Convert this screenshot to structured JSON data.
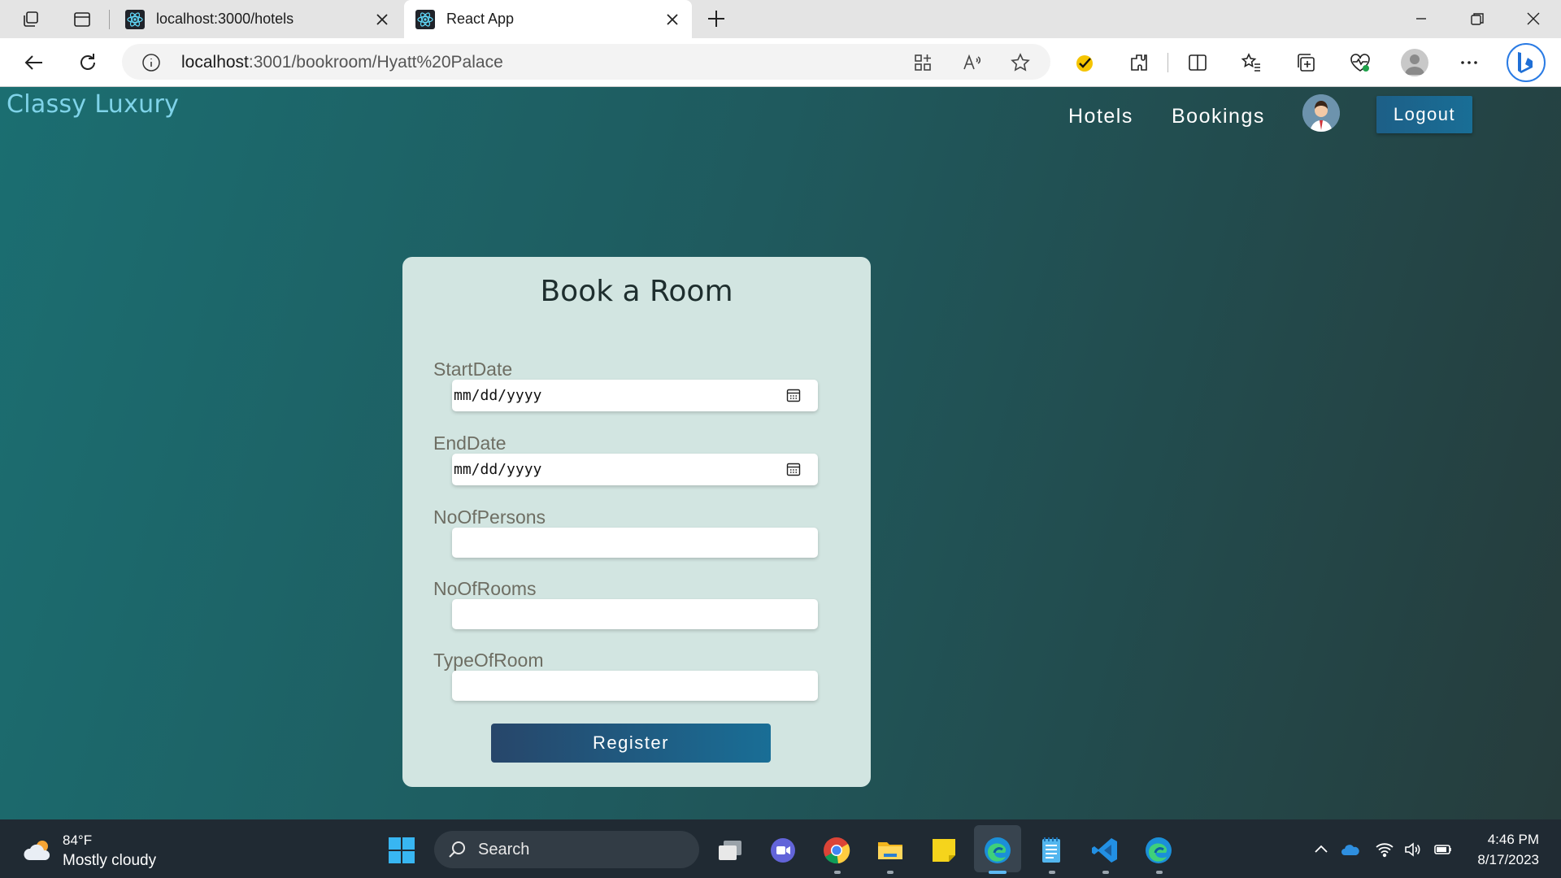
{
  "browser": {
    "tabs": [
      {
        "title": "localhost:3000/hotels",
        "active": false
      },
      {
        "title": "React App",
        "active": true
      }
    ],
    "url_host": "localhost",
    "url_path": ":3001/bookroom/Hyatt%20Palace"
  },
  "navbar": {
    "brand": "Classy Luxury",
    "links": [
      "Hotels",
      "Bookings"
    ],
    "logout_label": "Logout"
  },
  "form": {
    "title": "Book a Room",
    "fields": [
      {
        "label": "StartDate",
        "placeholder": "mm/dd/yyyy",
        "type": "date"
      },
      {
        "label": "EndDate",
        "placeholder": "mm/dd/yyyy",
        "type": "date"
      },
      {
        "label": "NoOfPersons",
        "value": ""
      },
      {
        "label": "NoOfRooms",
        "value": ""
      },
      {
        "label": "TypeOfRoom",
        "value": ""
      }
    ],
    "submit_label": "Register"
  },
  "taskbar": {
    "weather_temp": "84°F",
    "weather_desc": "Mostly cloudy",
    "search_label": "Search",
    "time": "4:46 PM",
    "date": "8/17/2023"
  },
  "colors": {
    "page_gradient_start": "#1b6e71",
    "page_gradient_end": "#263c3c",
    "card_bg": "#d2e5e1",
    "brand_text": "#7fd3e9",
    "button_blue": "#196e96"
  }
}
